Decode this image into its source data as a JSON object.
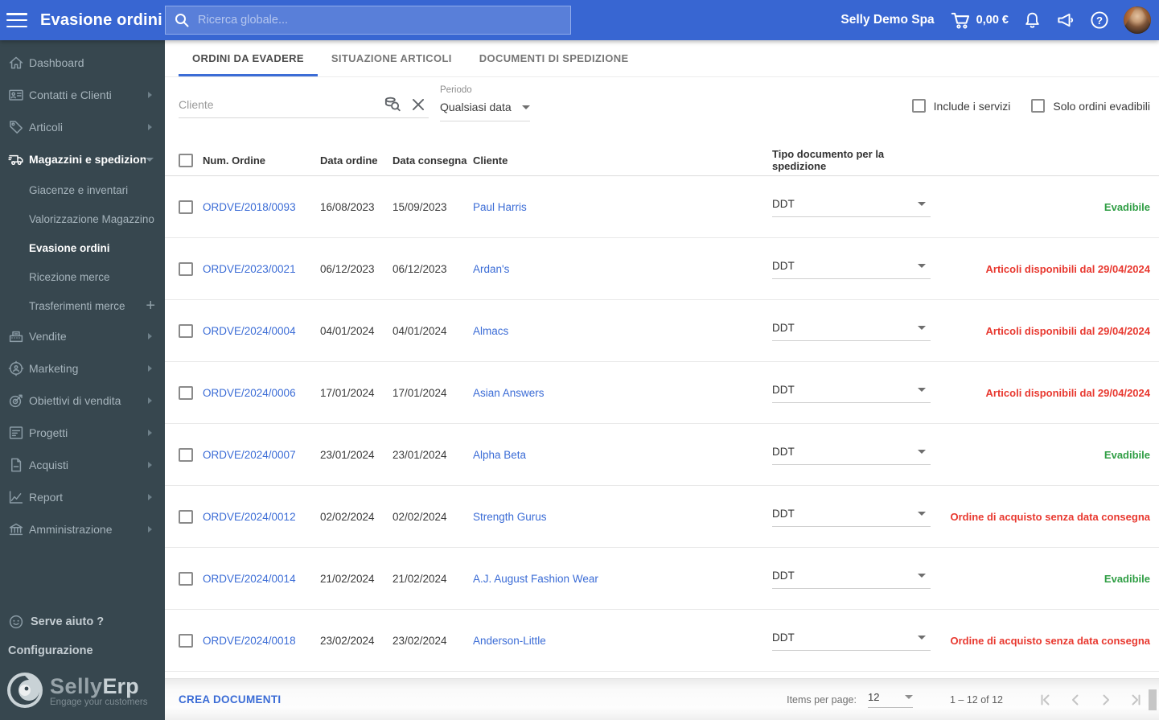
{
  "theme": {
    "header_blue": "#3866D2",
    "sidebar_dark": "#37474F",
    "link_blue": "#3B6CD6",
    "status_green": "#2F9E44",
    "status_red": "#E8382F"
  },
  "header": {
    "title": "Evasione ordini",
    "search_placeholder": "Ricerca globale...",
    "company_name": "Selly Demo Spa",
    "cart_total": "0,00 €"
  },
  "icons": {
    "help_glyph": "?",
    "plus_glyph": "+"
  },
  "sidebar": {
    "items": [
      {
        "label": "Dashboard",
        "icon": "home-icon"
      },
      {
        "label": "Contatti e Clienti",
        "icon": "contacts-icon"
      },
      {
        "label": "Articoli",
        "icon": "tag-icon"
      },
      {
        "label": "Magazzini e spedizion",
        "icon": "truck-icon",
        "expanded": true
      },
      {
        "label": "Vendite",
        "icon": "cash-register-icon"
      },
      {
        "label": "Marketing",
        "icon": "target-user-icon"
      },
      {
        "label": "Obiettivi di vendita",
        "icon": "dartboard-icon"
      },
      {
        "label": "Progetti",
        "icon": "task-list-icon"
      },
      {
        "label": "Acquisti",
        "icon": "document-icon"
      },
      {
        "label": "Report",
        "icon": "line-chart-icon"
      },
      {
        "label": "Amministrazione",
        "icon": "bank-icon"
      }
    ],
    "magazzini_children": [
      {
        "label": "Giacenze e inventari"
      },
      {
        "label": "Valorizzazione Magazzino"
      },
      {
        "label": "Evasione ordini",
        "active": true
      },
      {
        "label": "Ricezione merce"
      },
      {
        "label": "Trasferimenti merce",
        "has_plus": true
      }
    ],
    "help_label": "Serve aiuto ?",
    "config_label": "Configurazione",
    "logo_text_1": "Selly",
    "logo_text_2": "Erp",
    "logo_tagline": "Engage your customers"
  },
  "tabs": [
    {
      "label": "ORDINI DA EVADERE",
      "active": true
    },
    {
      "label": "SITUAZIONE ARTICOLI"
    },
    {
      "label": "DOCUMENTI DI SPEDIZIONE"
    }
  ],
  "filters": {
    "cliente_placeholder": "Cliente",
    "periodo_label": "Periodo",
    "periodo_value": "Qualsiasi data",
    "checkbox_servizi": "Include i servizi",
    "checkbox_evadibili": "Solo ordini evadibili"
  },
  "table": {
    "headers": {
      "num_ordine": "Num. Ordine",
      "data_ordine": "Data ordine",
      "data_consegna": "Data consegna",
      "cliente": "Cliente",
      "tipo_documento": "Tipo documento per la spedizione"
    },
    "rows": [
      {
        "order": "ORDVE/2018/0093",
        "date_order": "16/08/2023",
        "date_delivery": "15/09/2023",
        "client": "Paul Harris",
        "doc_type": "DDT",
        "status": "Evadibile",
        "status_color": "green"
      },
      {
        "order": "ORDVE/2023/0021",
        "date_order": "06/12/2023",
        "date_delivery": "06/12/2023",
        "client": "Ardan's",
        "doc_type": "DDT",
        "status": "Articoli disponibili dal 29/04/2024",
        "status_color": "red"
      },
      {
        "order": "ORDVE/2024/0004",
        "date_order": "04/01/2024",
        "date_delivery": "04/01/2024",
        "client": "Almacs",
        "doc_type": "DDT",
        "status": "Articoli disponibili dal 29/04/2024",
        "status_color": "red"
      },
      {
        "order": "ORDVE/2024/0006",
        "date_order": "17/01/2024",
        "date_delivery": "17/01/2024",
        "client": "Asian Answers",
        "doc_type": "DDT",
        "status": "Articoli disponibili dal 29/04/2024",
        "status_color": "red"
      },
      {
        "order": "ORDVE/2024/0007",
        "date_order": "23/01/2024",
        "date_delivery": "23/01/2024",
        "client": "Alpha Beta",
        "doc_type": "DDT",
        "status": "Evadibile",
        "status_color": "green"
      },
      {
        "order": "ORDVE/2024/0012",
        "date_order": "02/02/2024",
        "date_delivery": "02/02/2024",
        "client": "Strength Gurus",
        "doc_type": "DDT",
        "status": "Ordine di acquisto senza data consegna",
        "status_color": "red"
      },
      {
        "order": "ORDVE/2024/0014",
        "date_order": "21/02/2024",
        "date_delivery": "21/02/2024",
        "client": "A.J. August Fashion Wear",
        "doc_type": "DDT",
        "status": "Evadibile",
        "status_color": "green"
      },
      {
        "order": "ORDVE/2024/0018",
        "date_order": "23/02/2024",
        "date_delivery": "23/02/2024",
        "client": "Anderson-Little",
        "doc_type": "DDT",
        "status": "Ordine di acquisto senza data consegna",
        "status_color": "red"
      }
    ]
  },
  "footer": {
    "create_button": "CREA DOCUMENTI",
    "items_per_page_label": "Items per page:",
    "items_per_page_value": "12",
    "range_label": "1 – 12 of 12"
  }
}
